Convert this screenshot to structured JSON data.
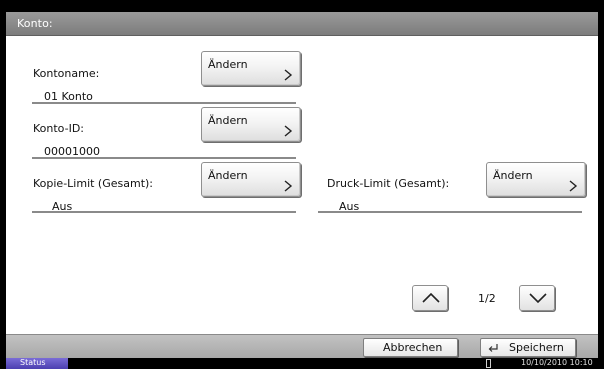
{
  "screen": {
    "title": "Konto:"
  },
  "fields": [
    {
      "label": "Kontoname:",
      "value": "01 Konto",
      "button": "Ändern"
    },
    {
      "label": "Konto-ID:",
      "value": "00001000",
      "button": "Ändern"
    },
    {
      "label": "Kopie-Limit (Gesamt):",
      "value": "Aus",
      "button": "Ändern"
    },
    {
      "label": "Druck-Limit (Gesamt):",
      "value": "Aus",
      "button": "Ändern"
    }
  ],
  "pager": {
    "indicator": "1/2"
  },
  "footer": {
    "cancel_label": "Abbrechen",
    "save_label": "Speichern"
  },
  "statusbar": {
    "status_label": "Status",
    "datetime": "10/10/2010  10:10"
  }
}
